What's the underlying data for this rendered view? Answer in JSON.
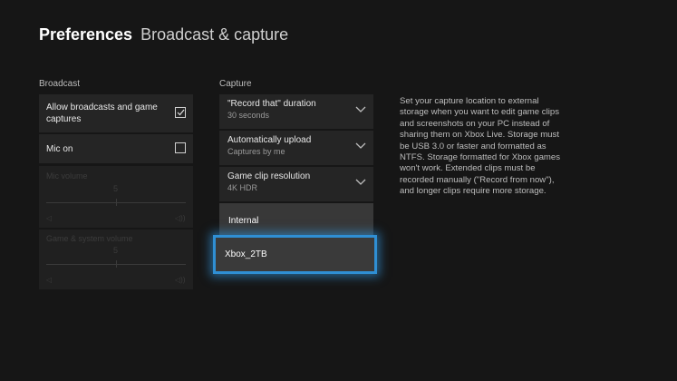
{
  "header": {
    "title_bold": "Preferences",
    "title_light": "Broadcast & capture"
  },
  "broadcast": {
    "label": "Broadcast",
    "allow_label": "Allow broadcasts and game captures",
    "allow_checked": true,
    "mic_label": "Mic on",
    "mic_checked": false,
    "mic_volume": {
      "label": "Mic volume",
      "value": "5"
    },
    "game_volume": {
      "label": "Game & system volume",
      "value": "5"
    }
  },
  "capture": {
    "label": "Capture",
    "dropdowns": [
      {
        "label": "\"Record that\" duration",
        "value": "30 seconds"
      },
      {
        "label": "Automatically upload",
        "value": "Captures by me"
      },
      {
        "label": "Game clip resolution",
        "value": "4K HDR"
      }
    ],
    "options": [
      "Internal",
      "Xbox_2TB"
    ],
    "focused_option": "Xbox_2TB"
  },
  "description": "Set your capture location to external storage when you want to edit game clips and screenshots on your PC instead of sharing them on Xbox Live. Storage must be USB 3.0 or faster and formatted as NTFS. Storage formatted for Xbox games won't work. Extended clips must be recorded manually (\"Record from now\"), and longer clips require more storage.",
  "colors": {
    "background": "#161616",
    "panel": "#252525",
    "focus": "#2f8fd4"
  }
}
